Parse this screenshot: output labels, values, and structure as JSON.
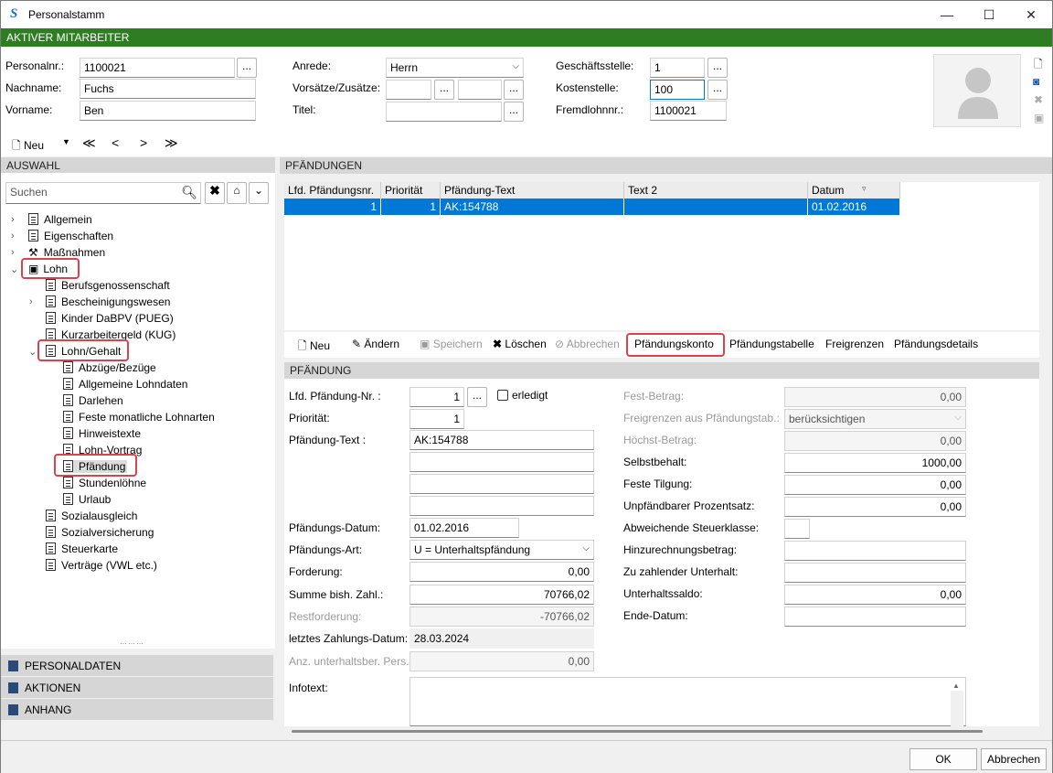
{
  "window": {
    "title": "Personalstamm",
    "minimize": "—",
    "maximize": "☐",
    "close": "✕"
  },
  "banner": "AKTIVER MITARBEITER",
  "header": {
    "personalnr_label": "Personalnr.:",
    "personalnr": "1100021",
    "nachname_label": "Nachname:",
    "nachname": "Fuchs",
    "vorname_label": "Vorname:",
    "vorname": "Ben",
    "anrede_label": "Anrede:",
    "anrede": "Herrn",
    "vorsaetze_label": "Vorsätze/Zusätze:",
    "titel_label": "Titel:",
    "geschaeftsstelle_label": "Geschäftsstelle:",
    "geschaeftsstelle": "1",
    "kostenstelle_label": "Kostenstelle:",
    "kostenstelle": "100",
    "fremdlohn_label": "Fremdlohnnr.:",
    "fremdlohn": "1100021",
    "dots": "..."
  },
  "nav": {
    "new": "Neu",
    "first": "≪",
    "prev": "<",
    "next": ">",
    "last": "≫"
  },
  "left": {
    "header": "AUSWAHL",
    "search_placeholder": "Suchen",
    "tree": [
      {
        "label": "Allgemein"
      },
      {
        "label": "Eigenschaften"
      },
      {
        "label": "Maßnahmen"
      },
      {
        "label": "Lohn"
      },
      {
        "label": "Berufsgenossenschaft"
      },
      {
        "label": "Bescheinigungswesen"
      },
      {
        "label": "Kinder DaBPV (PUEG)"
      },
      {
        "label": "Kurzarbeitergeld (KUG)"
      },
      {
        "label": "Lohn/Gehalt"
      },
      {
        "label": "Abzüge/Bezüge"
      },
      {
        "label": "Allgemeine Lohndaten"
      },
      {
        "label": "Darlehen"
      },
      {
        "label": "Feste monatliche Lohnarten"
      },
      {
        "label": "Hinweistexte"
      },
      {
        "label": "Lohn-Vortrag"
      },
      {
        "label": "Pfändung"
      },
      {
        "label": "Stundenlöhne"
      },
      {
        "label": "Urlaub"
      },
      {
        "label": "Sozialausgleich"
      },
      {
        "label": "Sozialversicherung"
      },
      {
        "label": "Steuerkarte"
      },
      {
        "label": "Verträge (VWL etc.)"
      }
    ],
    "accordion": [
      "PERSONALDATEN",
      "AKTIONEN",
      "ANHANG"
    ]
  },
  "main": {
    "header": "PFÄNDUNGEN",
    "columns": [
      "Lfd. Pfändungsnr.",
      "Priorität",
      "Pfändung-Text",
      "Text 2",
      "Datum"
    ],
    "rows": [
      [
        "1",
        "1",
        "AK:154788",
        "",
        "01.02.2016"
      ]
    ],
    "toolbar": {
      "new": "Neu",
      "edit": "Ändern",
      "save": "Speichern",
      "delete": "Löschen",
      "cancel": "Abbrechen",
      "konto": "Pfändungskonto",
      "tabelle": "Pfändungstabelle",
      "freigrenzen": "Freigrenzen",
      "details": "Pfändungsdetails"
    },
    "section": "PFÄNDUNG",
    "form": {
      "lfd_label": "Lfd. Pfändung-Nr. :",
      "lfd": "1",
      "erledigt": "erledigt",
      "prio_label": "Priorität:",
      "prio": "1",
      "text_label": "Pfändung-Text :",
      "text": "AK:154788",
      "datum_label": "Pfändungs-Datum:",
      "datum": "01.02.2016",
      "art_label": "Pfändungs-Art:",
      "art": "U = Unterhaltspfändung",
      "forderung_label": "Forderung:",
      "forderung": "0,00",
      "summe_label": "Summe bish. Zahl.:",
      "summe": "70766,02",
      "rest_label": "Restforderung:",
      "rest": "-70766,02",
      "letztes_label": "letztes Zahlungs-Datum:",
      "letztes": "28.03.2024",
      "anz_label": "Anz. unterhaltsber. Pers.:",
      "anz": "0,00",
      "info_label": "Infotext:",
      "fest_label": "Fest-Betrag:",
      "fest": "0,00",
      "freig_label": "Freigrenzen aus Pfändungstab.:",
      "freig": "berücksichtigen",
      "hoechst_label": "Höchst-Betrag:",
      "hoechst": "0,00",
      "selbst_label": "Selbstbehalt:",
      "selbst": "1000,00",
      "tilgung_label": "Feste Tilgung:",
      "tilgung": "0,00",
      "prozent_label": "Unpfändbarer Prozentsatz:",
      "prozent": "0,00",
      "steuer_label": "Abweichende Steuerklasse:",
      "hinzu_label": "Hinzurechnungsbetrag:",
      "zuzahl_label": "Zu zahlender Unterhalt:",
      "saldo_label": "Unterhaltssaldo:",
      "saldo": "0,00",
      "ende_label": "Ende-Datum:"
    }
  },
  "footer": {
    "ok": "OK",
    "cancel": "Abbrechen"
  }
}
